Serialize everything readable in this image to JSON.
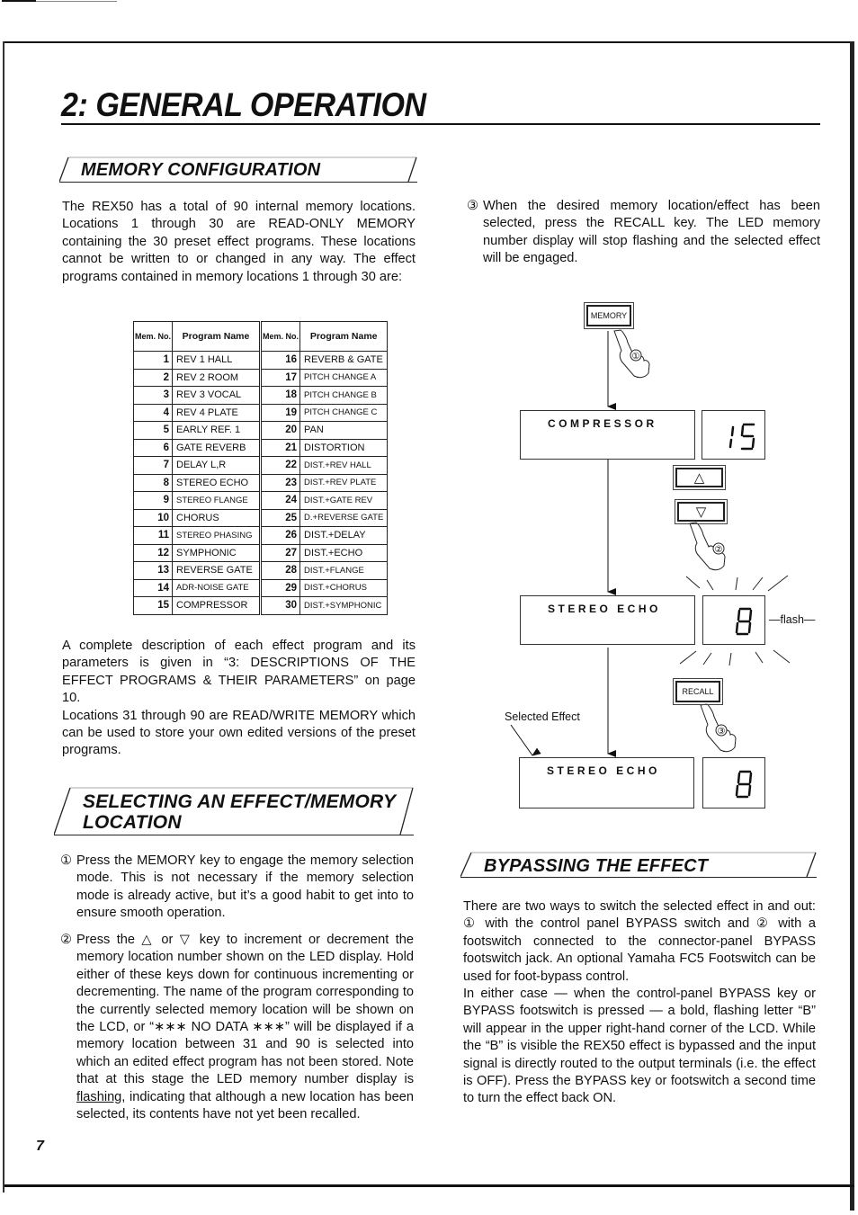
{
  "page": {
    "title": "2: GENERAL OPERATION",
    "page_number": "7"
  },
  "memory_config": {
    "heading": "MEMORY CONFIGURATION",
    "intro": "The REX50 has a total of 90 internal memory locations. Locations 1 through 30 are READ-ONLY MEMORY containing the 30 preset effect programs. These locations cannot be written to or changed in any way. The effect programs contained in memory locations 1 through 30 are:",
    "table": {
      "headers": {
        "mem_no": "Mem. No.",
        "program_name": "Program Name"
      },
      "left": [
        {
          "no": "1",
          "name": "REV 1 HALL"
        },
        {
          "no": "2",
          "name": "REV 2 ROOM"
        },
        {
          "no": "3",
          "name": "REV 3 VOCAL"
        },
        {
          "no": "4",
          "name": "REV 4 PLATE"
        },
        {
          "no": "5",
          "name": "EARLY REF. 1"
        },
        {
          "no": "6",
          "name": "GATE REVERB"
        },
        {
          "no": "7",
          "name": "DELAY L,R"
        },
        {
          "no": "8",
          "name": "STEREO ECHO"
        },
        {
          "no": "9",
          "name": "STEREO FLANGE"
        },
        {
          "no": "10",
          "name": "CHORUS"
        },
        {
          "no": "11",
          "name": "STEREO PHASING"
        },
        {
          "no": "12",
          "name": "SYMPHONIC"
        },
        {
          "no": "13",
          "name": "REVERSE GATE"
        },
        {
          "no": "14",
          "name": "ADR-NOISE GATE"
        },
        {
          "no": "15",
          "name": "COMPRESSOR"
        }
      ],
      "right": [
        {
          "no": "16",
          "name": "REVERB & GATE"
        },
        {
          "no": "17",
          "name": "PITCH CHANGE A"
        },
        {
          "no": "18",
          "name": "PITCH CHANGE B"
        },
        {
          "no": "19",
          "name": "PITCH CHANGE C"
        },
        {
          "no": "20",
          "name": "PAN"
        },
        {
          "no": "21",
          "name": "DISTORTION"
        },
        {
          "no": "22",
          "name": "DIST.+REV HALL"
        },
        {
          "no": "23",
          "name": "DIST.+REV PLATE"
        },
        {
          "no": "24",
          "name": "DIST.+GATE REV"
        },
        {
          "no": "25",
          "name": "D.+REVERSE GATE"
        },
        {
          "no": "26",
          "name": "DIST.+DELAY"
        },
        {
          "no": "27",
          "name": "DIST.+ECHO"
        },
        {
          "no": "28",
          "name": "DIST.+FLANGE"
        },
        {
          "no": "29",
          "name": "DIST.+CHORUS"
        },
        {
          "no": "30",
          "name": "DIST.+SYMPHONIC"
        }
      ]
    },
    "description": "A complete description of each effect program and its parameters is given in “3: DESCRIPTIONS OF THE EFFECT PROGRAMS & THEIR PARAMETERS” on page 10.",
    "read_write": "Locations 31 through 90 are READ/WRITE MEMORY which can be used to store your own edited versions of the preset programs."
  },
  "selecting": {
    "heading_line1": "SELECTING AN EFFECT/MEMORY",
    "heading_line2": "LOCATION",
    "step1_num": "①",
    "step1": "Press the MEMORY key to engage the memory selection mode. This is not necessary if the memory selection mode is already active, but it’s a good habit to get into to ensure smooth operation.",
    "step2_num": "②",
    "step2_a": "Press the △ or ▽ key to increment or decrement the memory location number shown on the LED display. Hold either of these keys down for continuous incrementing or decrementing. The name of the program corresponding to the currently selected memory location will be shown on the LCD, or “∗∗∗ NO DATA ∗∗∗” will be displayed if a memory location between 31 and 90 is selected into which an edited effect program has not been stored. Note that at this stage the LED memory number display is ",
    "step2_underline": "flashing,",
    "step2_b": " indicating that although a new location has been selected, its contents have not yet been recalled.",
    "step3_num": "③",
    "step3": "When the desired memory location/effect has been selected, press the RECALL key. The LED memory number display will stop flashing and the selected effect will be engaged."
  },
  "diagram": {
    "memory_key": "MEMORY",
    "recall_key": "RECALL",
    "lcd1": "COMPRESSOR",
    "led1": "15",
    "lcd2": "STEREO ECHO",
    "led2": "8",
    "flash_label": "—flash—",
    "lcd3": "STEREO ECHO",
    "led3": "8",
    "selected_label": "Selected Effect",
    "callout1": "①",
    "callout2": "②",
    "callout3": "③"
  },
  "bypassing": {
    "heading": "BYPASSING THE EFFECT",
    "para1": "There are two ways to switch the selected effect in and out: ① with the control panel BYPASS switch and ② with a footswitch connected to the connector-panel BYPASS footswitch jack. An optional Yamaha FC5 Footswitch can be used for foot-bypass control.",
    "para2": "In either case — when the control-panel BYPASS key or BYPASS footswitch is pressed — a bold, flashing letter “B” will appear in the upper right-hand corner of the LCD. While the “B” is visible the REX50 effect is bypassed and the input signal is directly routed to the output terminals (i.e. the effect is OFF). Press the BYPASS key or footswitch a second time to turn the effect back ON."
  }
}
